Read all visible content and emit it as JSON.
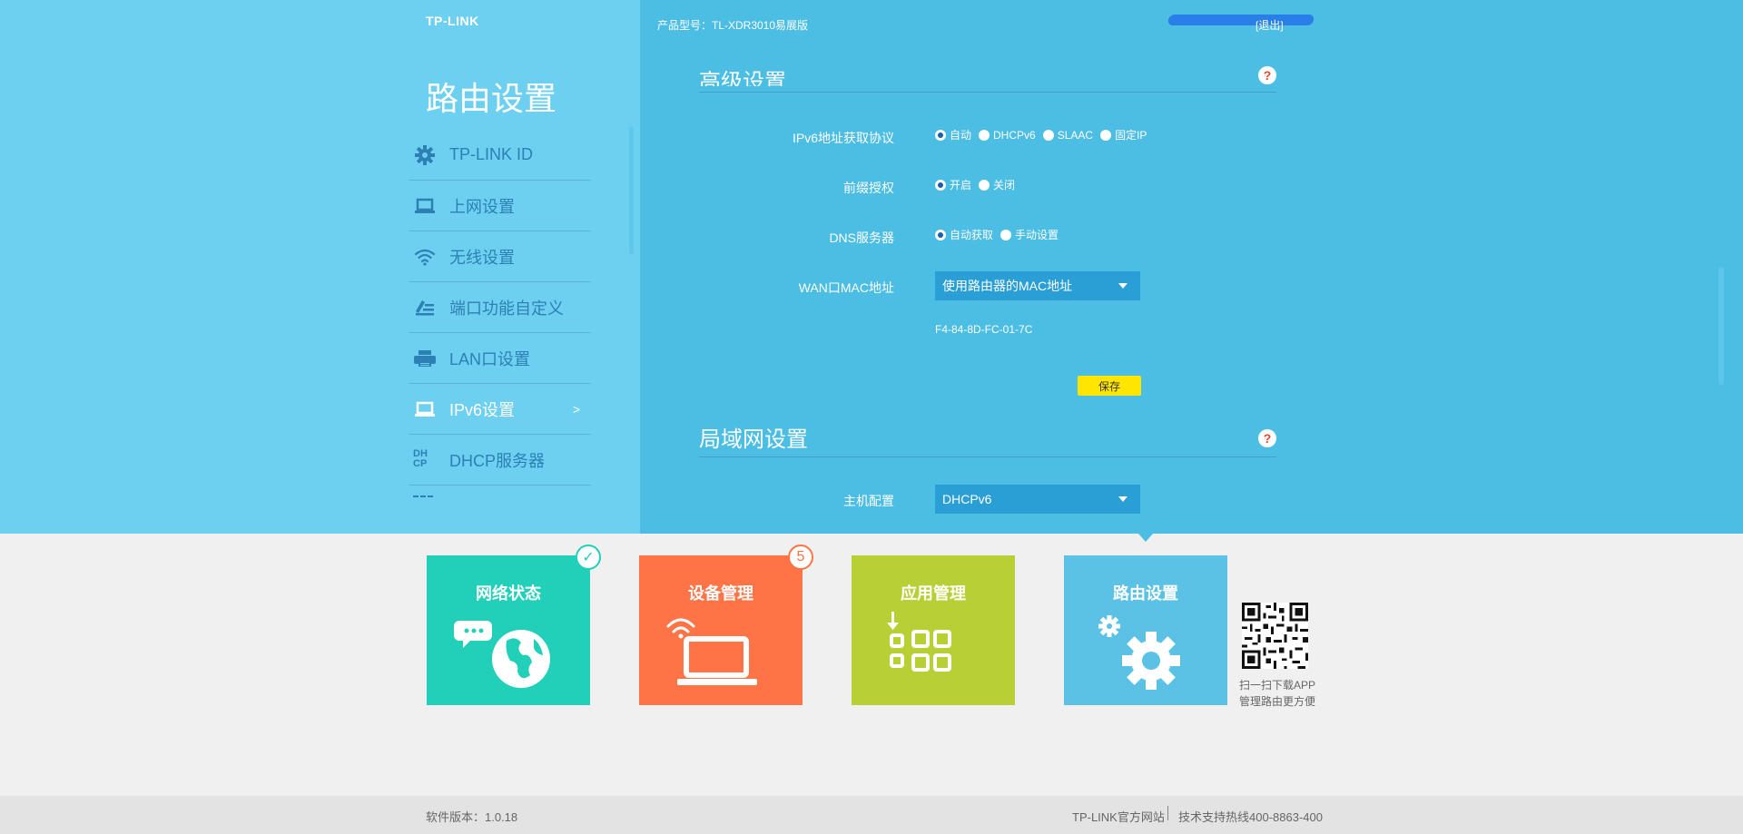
{
  "header": {
    "logo": "TP-LINK",
    "model": "产品型号：TL-XDR3010易展版",
    "logout": "[退出]"
  },
  "page_title": "路由设置",
  "sidebar": {
    "items": [
      {
        "label": "TP-LINK ID",
        "icon": "gear-icon"
      },
      {
        "label": "上网设置",
        "icon": "laptop-icon"
      },
      {
        "label": "无线设置",
        "icon": "wifi-icon"
      },
      {
        "label": "端口功能自定义",
        "icon": "edit-list-icon"
      },
      {
        "label": "LAN口设置",
        "icon": "printer-icon"
      },
      {
        "label": "IPv6设置",
        "icon": "laptop-icon",
        "arrow": ">"
      },
      {
        "label": "DHCP服务器",
        "icon": "dhcp-icon",
        "icon_text": "DH CP"
      }
    ]
  },
  "main": {
    "section1_title": "高级设置",
    "ipv6_protocol": {
      "label": "IPv6地址获取协议",
      "options": [
        "自动",
        "DHCPv6",
        "SLAAC",
        "固定IP"
      ],
      "selected": "自动"
    },
    "prefix_delegation": {
      "label": "前缀授权",
      "options": [
        "开启",
        "关闭"
      ],
      "selected": "开启"
    },
    "dns": {
      "label": "DNS服务器",
      "options": [
        "自动获取",
        "手动设置"
      ],
      "selected": "自动获取"
    },
    "wan_mac": {
      "label": "WAN口MAC地址",
      "value": "使用路由器的MAC地址",
      "mac": "F4-84-8D-FC-01-7C"
    },
    "save_label": "保存",
    "section2_title": "局域网设置",
    "host_config": {
      "label": "主机配置",
      "value": "DHCPv6"
    },
    "help_glyph": "?"
  },
  "tiles": [
    {
      "label": "网络状态",
      "icon": "globe-chat-icon",
      "badge": "✓",
      "color": "#22cfb9"
    },
    {
      "label": "设备管理",
      "icon": "laptop-wifi-icon",
      "badge": "5",
      "color": "#ff7447"
    },
    {
      "label": "应用管理",
      "icon": "apps-grid-icon",
      "color": "#b8cf35"
    },
    {
      "label": "路由设置",
      "icon": "gears-icon",
      "color": "#5bc2e5"
    }
  ],
  "qr": {
    "line1": "扫一扫下载APP",
    "line2": "管理路由更方便"
  },
  "footer": {
    "version": "软件版本：1.0.18",
    "site": "TP-LINK官方网站",
    "hotline": "技术支持热线400-8863-400"
  }
}
